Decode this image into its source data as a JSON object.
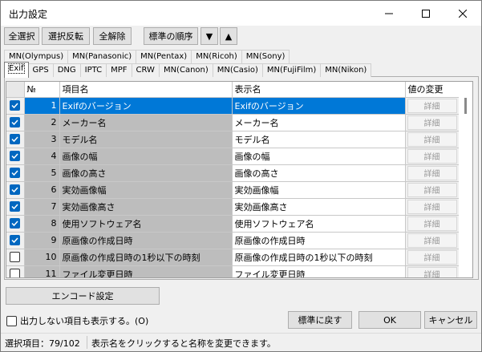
{
  "window": {
    "title": "出力設定"
  },
  "toolbar": {
    "select_all": "全選択",
    "invert": "選択反転",
    "clear_all": "全解除",
    "default_order": "標準の順序",
    "down_glyph": "▼",
    "up_glyph": "▲"
  },
  "tabs_row1": [
    "MN(Olympus)",
    "MN(Panasonic)",
    "MN(Pentax)",
    "MN(Ricoh)",
    "MN(Sony)"
  ],
  "tabs_row2": [
    "Exif",
    "GPS",
    "DNG",
    "IPTC",
    "MPF",
    "CRW",
    "MN(Canon)",
    "MN(Casio)",
    "MN(FujiFilm)",
    "MN(Nikon)"
  ],
  "table": {
    "headers": {
      "num": "№",
      "item": "項目名",
      "display": "表示名",
      "change": "値の変更"
    },
    "change_label": "詳細",
    "rows": [
      {
        "checked": true,
        "num": "1",
        "item": "Exifのバージョン",
        "display": "Exifのバージョン"
      },
      {
        "checked": true,
        "num": "2",
        "item": "メーカー名",
        "display": "メーカー名"
      },
      {
        "checked": true,
        "num": "3",
        "item": "モデル名",
        "display": "モデル名"
      },
      {
        "checked": true,
        "num": "4",
        "item": "画像の幅",
        "display": "画像の幅"
      },
      {
        "checked": true,
        "num": "5",
        "item": "画像の高さ",
        "display": "画像の高さ"
      },
      {
        "checked": true,
        "num": "6",
        "item": "実効画像幅",
        "display": "実効画像幅"
      },
      {
        "checked": true,
        "num": "7",
        "item": "実効画像高さ",
        "display": "実効画像高さ"
      },
      {
        "checked": true,
        "num": "8",
        "item": "使用ソフトウェア名",
        "display": "使用ソフトウェア名"
      },
      {
        "checked": true,
        "num": "9",
        "item": "原画像の作成日時",
        "display": "原画像の作成日時"
      },
      {
        "checked": false,
        "num": "10",
        "item": "原画像の作成日時の1秒以下の時刻",
        "display": "原画像の作成日時の1秒以下の時刻"
      },
      {
        "checked": false,
        "num": "11",
        "item": "ファイル変更日時",
        "display": "ファイル変更日時"
      }
    ]
  },
  "encode_button": "エンコード設定",
  "show_hidden_label": "出力しない項目も表示する。(O)",
  "buttons": {
    "reset": "標準に戻す",
    "ok": "OK",
    "cancel": "キャンセル"
  },
  "status": {
    "selected": "選択項目：79/102",
    "hint": "表示名をクリックすると名称を変更できます。"
  }
}
